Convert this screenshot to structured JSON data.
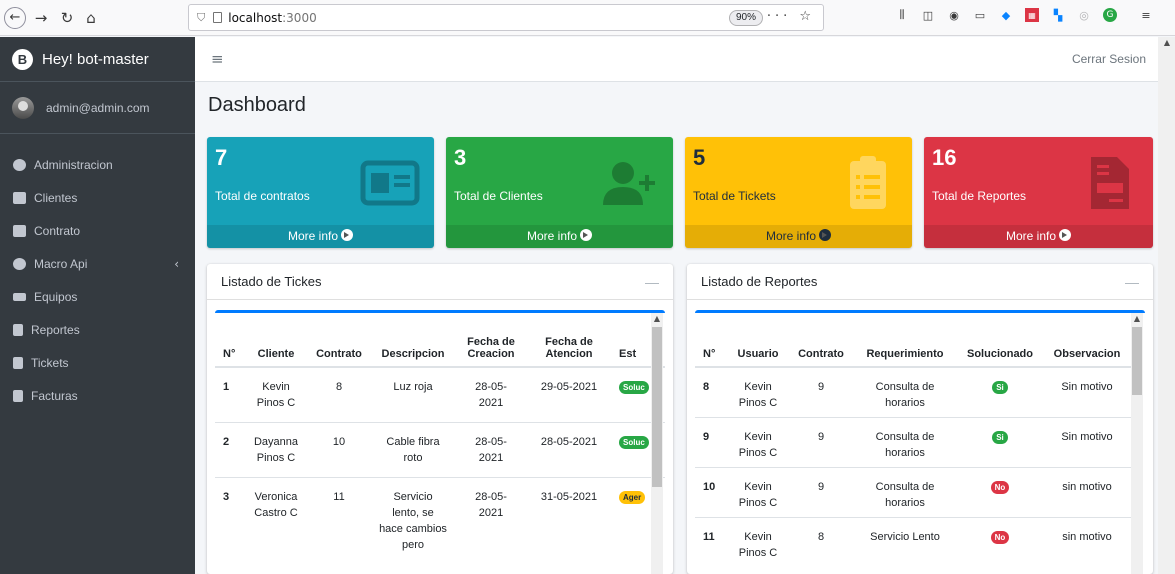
{
  "browser": {
    "url_host": "localhost",
    "url_port": ":3000",
    "zoom": "90%",
    "actions": "··· ☆"
  },
  "sidebar": {
    "brand": "Hey! bot-master",
    "user": "admin@admin.com",
    "items": [
      {
        "label": "Administracion"
      },
      {
        "label": "Clientes"
      },
      {
        "label": "Contrato"
      },
      {
        "label": "Macro Api",
        "chevron": "‹"
      },
      {
        "label": "Equipos"
      },
      {
        "label": "Reportes"
      },
      {
        "label": "Tickets"
      },
      {
        "label": "Facturas"
      }
    ]
  },
  "topnav": {
    "menu_glyph": "≡",
    "logout": "Cerrar Sesion"
  },
  "page": {
    "title": "Dashboard"
  },
  "info_boxes": [
    {
      "number": "7",
      "label": "Total de contratos",
      "more": "More info",
      "color": "#17a2b8",
      "icon": "id-card-icon"
    },
    {
      "number": "3",
      "label": "Total de Clientes",
      "more": "More info",
      "color": "#28a745",
      "icon": "user-plus-icon"
    },
    {
      "number": "5",
      "label": "Total de Tickets",
      "more": "More info",
      "color": "#ffc107",
      "icon": "clipboard-list-icon"
    },
    {
      "number": "16",
      "label": "Total de Reportes",
      "more": "More info",
      "color": "#dc3545",
      "icon": "file-invoice-icon"
    }
  ],
  "tickets_card": {
    "title": "Listado de Tickes",
    "minimize": "—",
    "headers": [
      "N°",
      "Cliente",
      "Contrato",
      "Descripcion",
      "Fecha de Creacion",
      "Fecha de Atencion",
      "Est"
    ],
    "rows": [
      {
        "n": "1",
        "cliente": "Kevin Pinos C",
        "contrato": "8",
        "descripcion": "Luz roja",
        "creacion": "28-05-2021",
        "atencion": "29-05-2021",
        "estado": "Soluc"
      },
      {
        "n": "2",
        "cliente": "Dayanna Pinos C",
        "contrato": "10",
        "descripcion": "Cable fibra roto",
        "creacion": "28-05-2021",
        "atencion": "28-05-2021",
        "estado": "Soluc"
      },
      {
        "n": "3",
        "cliente": "Veronica Castro C",
        "contrato": "11",
        "descripcion": "Servicio lento, se hace cambios pero",
        "creacion": "28-05-2021",
        "atencion": "31-05-2021",
        "estado": "Ager"
      }
    ]
  },
  "reportes_card": {
    "title": "Listado de Reportes",
    "minimize": "—",
    "headers": [
      "N°",
      "Usuario",
      "Contrato",
      "Requerimiento",
      "Solucionado",
      "Observacion"
    ],
    "rows": [
      {
        "n": "8",
        "usuario": "Kevin Pinos C",
        "contrato": "9",
        "requerimiento": "Consulta de horarios",
        "solucionado": "Si",
        "observacion": "Sin motivo"
      },
      {
        "n": "9",
        "usuario": "Kevin Pinos C",
        "contrato": "9",
        "requerimiento": "Consulta de horarios",
        "solucionado": "Si",
        "observacion": "Sin motivo"
      },
      {
        "n": "10",
        "usuario": "Kevin Pinos C",
        "contrato": "9",
        "requerimiento": "Consulta de horarios",
        "solucionado": "No",
        "observacion": "sin motivo"
      },
      {
        "n": "11",
        "usuario": "Kevin Pinos C",
        "contrato": "8",
        "requerimiento": "Servicio Lento",
        "solucionado": "No",
        "observacion": "sin motivo"
      }
    ]
  }
}
